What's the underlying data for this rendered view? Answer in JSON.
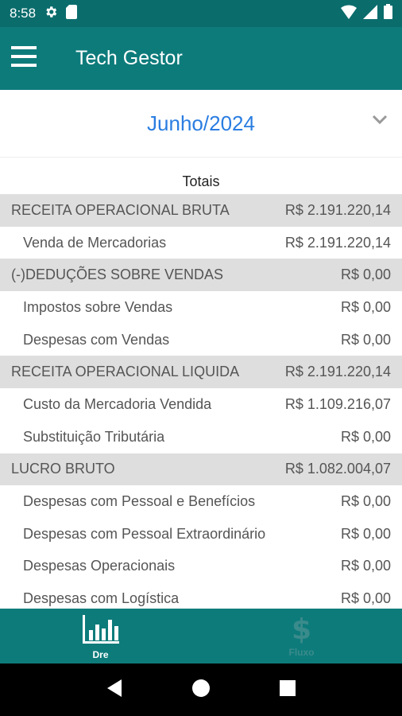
{
  "status_bar": {
    "time": "8:58"
  },
  "app_bar": {
    "title": "Tech Gestor"
  },
  "period": {
    "selected": "Junho/2024"
  },
  "totals": {
    "title": "Totais"
  },
  "rows": [
    {
      "label": "RECEITA OPERACIONAL BRUTA",
      "value": "R$ 2.191.220,14"
    },
    {
      "label": "Venda de Mercadorias",
      "value": "R$ 2.191.220,14"
    },
    {
      "label": "(-)DEDUÇÕES SOBRE VENDAS",
      "value": "R$ 0,00"
    },
    {
      "label": "Impostos sobre Vendas",
      "value": "R$ 0,00"
    },
    {
      "label": "Despesas com Vendas",
      "value": "R$ 0,00"
    },
    {
      "label": "RECEITA OPERACIONAL LIQUIDA",
      "value": "R$ 2.191.220,14"
    },
    {
      "label": "Custo da Mercadoria Vendida",
      "value": "R$ 1.109.216,07"
    },
    {
      "label": "Substituição Tributária",
      "value": "R$ 0,00"
    },
    {
      "label": "LUCRO BRUTO",
      "value": "R$ 1.082.004,07"
    },
    {
      "label": "Despesas com Pessoal e Benefícios",
      "value": "R$ 0,00"
    },
    {
      "label": "Despesas com Pessoal Extraordinário",
      "value": "R$ 0,00"
    },
    {
      "label": "Despesas Operacionais",
      "value": "R$ 0,00"
    },
    {
      "label": "Despesas com Logística",
      "value": "R$ 0,00"
    }
  ],
  "bottom_nav": {
    "items": [
      {
        "label": "Dre",
        "icon": "bar-chart-icon"
      },
      {
        "label": "Fluxo",
        "icon": "dollar-icon"
      }
    ],
    "dollar_glyph": "$"
  },
  "colors": {
    "app_bar": "#0e7b7b",
    "status_bar": "#0b6c6c",
    "period_text": "#2a7de1",
    "group_row_bg": "#dedede"
  }
}
